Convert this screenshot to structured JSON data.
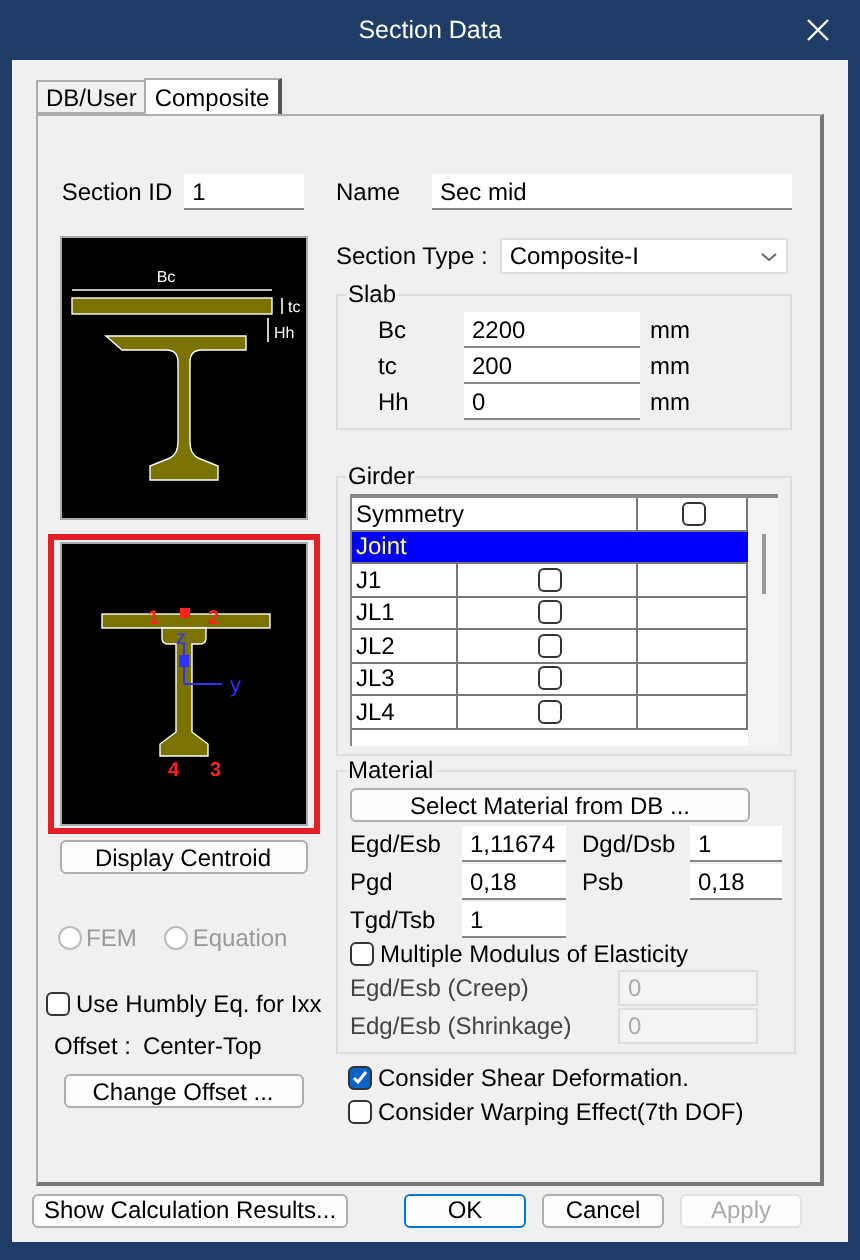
{
  "window": {
    "title": "Section Data"
  },
  "tabs": [
    {
      "label": "DB/User",
      "selected": false
    },
    {
      "label": "Composite",
      "selected": true
    }
  ],
  "section_id": {
    "label": "Section ID",
    "value": "1"
  },
  "name": {
    "label": "Name",
    "value": "Sec mid"
  },
  "section_type": {
    "label": "Section Type :",
    "value": "Composite-I"
  },
  "dimension_drawing": {
    "labels": [
      "Bc",
      "tc",
      "Hh"
    ]
  },
  "centroid_drawing": {
    "points": [
      "1",
      "2",
      "4",
      "3"
    ],
    "axes": [
      "z",
      "y"
    ]
  },
  "display_centroid": "Display Centroid",
  "methods": [
    {
      "label": "FEM",
      "selected": false,
      "disabled": true
    },
    {
      "label": "Equation",
      "selected": false,
      "disabled": true
    }
  ],
  "humbly": {
    "label": "Use Humbly Eq. for Ixx",
    "checked": false
  },
  "offset": {
    "label": "Offset :",
    "value": "Center-Top"
  },
  "change_offset": "Change Offset ...",
  "slab": {
    "title": "Slab",
    "fields": [
      {
        "label": "Bc",
        "value": "2200",
        "unit": "mm"
      },
      {
        "label": "tc",
        "value": "200",
        "unit": "mm"
      },
      {
        "label": "Hh",
        "value": "0",
        "unit": "mm"
      }
    ]
  },
  "girder": {
    "title": "Girder",
    "symmetry": {
      "label": "Symmetry",
      "checked": false
    },
    "rows": [
      {
        "kind": "group",
        "label": "Joint",
        "selected": true
      },
      {
        "kind": "joint",
        "label": "J1",
        "checked": false,
        "selected": false
      },
      {
        "kind": "joint",
        "label": "JL1",
        "checked": false,
        "selected": false
      },
      {
        "kind": "joint",
        "label": "JL2",
        "checked": false,
        "selected": false
      },
      {
        "kind": "joint",
        "label": "JL3",
        "checked": false,
        "selected": false
      },
      {
        "kind": "joint",
        "label": "JL4",
        "checked": false,
        "selected": false
      }
    ]
  },
  "material": {
    "title": "Material",
    "select_button": "Select Material from DB ...",
    "fields": [
      {
        "label": "Egd/Esb",
        "value": "1,11674"
      },
      {
        "label": "Dgd/Dsb",
        "value": "1"
      },
      {
        "label": "Pgd",
        "value": "0,18"
      },
      {
        "label": "Psb",
        "value": "0,18"
      },
      {
        "label": "Tgd/Tsb",
        "value": "1"
      }
    ],
    "multiple": {
      "label": "Multiple Modulus of Elasticity",
      "checked": false
    },
    "extra_fields": [
      {
        "label": "Egd/Esb (Creep)",
        "value": "0",
        "disabled": true
      },
      {
        "label": "Edg/Esb (Shrinkage)",
        "value": "0",
        "disabled": true
      }
    ]
  },
  "options": [
    {
      "label": "Consider Shear Deformation.",
      "checked": true
    },
    {
      "label": "Consider Warping Effect(7th DOF)",
      "checked": false
    }
  ],
  "buttons": [
    {
      "label": "Show Calculation Results...",
      "disabled": false,
      "default": false
    },
    {
      "label": "OK",
      "disabled": false,
      "default": true
    },
    {
      "label": "Cancel",
      "disabled": false,
      "default": false
    },
    {
      "label": "Apply",
      "disabled": true,
      "default": false
    }
  ]
}
